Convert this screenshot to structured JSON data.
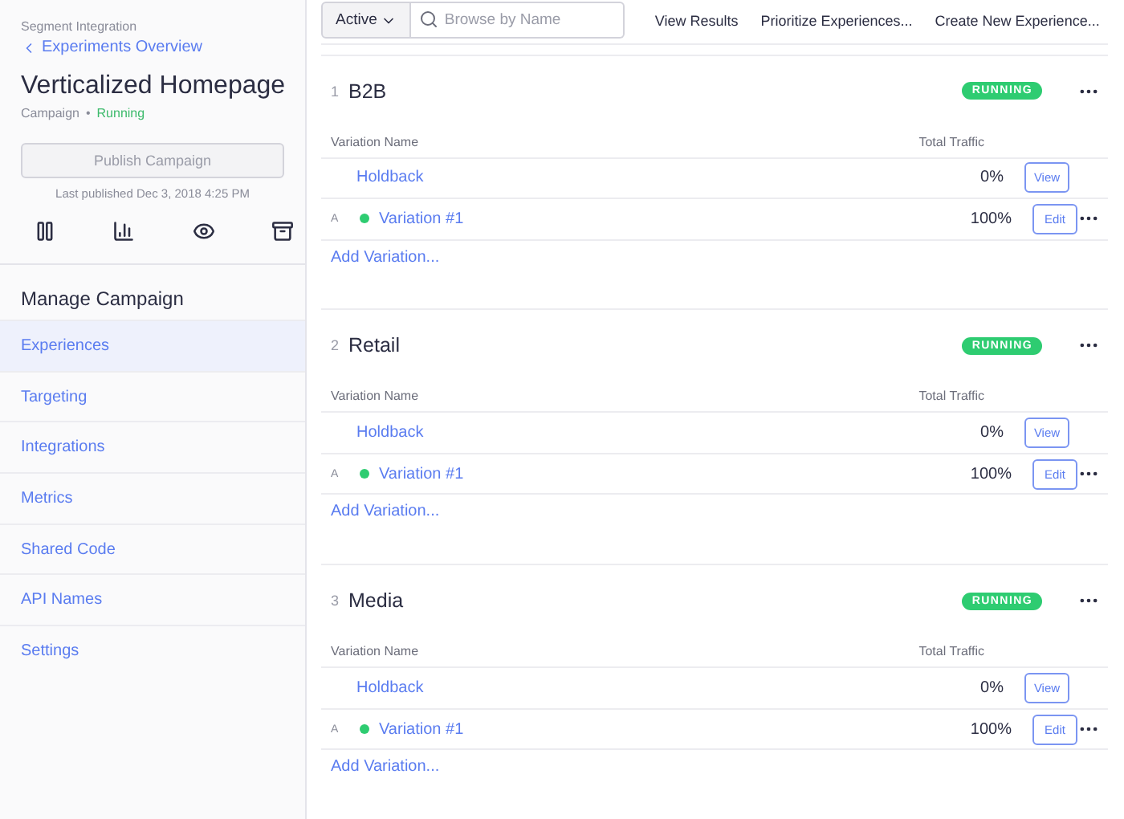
{
  "sidebar": {
    "breadcrumb": "Segment Integration",
    "back_link": "Experiments Overview",
    "title": "Verticalized Homepage",
    "type": "Campaign",
    "separator": "•",
    "status": "Running",
    "publish_button": {
      "label": "Publish Campaign",
      "disabled": true
    },
    "last_published": "Last published Dec 3, 2018 4:25 PM",
    "section_title": "Manage Campaign",
    "nav": [
      {
        "label": "Experiences",
        "selected": true
      },
      {
        "label": "Targeting",
        "selected": false
      },
      {
        "label": "Integrations",
        "selected": false
      },
      {
        "label": "Metrics",
        "selected": false
      },
      {
        "label": "Shared Code",
        "selected": false
      },
      {
        "label": "API Names",
        "selected": false
      },
      {
        "label": "Settings",
        "selected": false
      }
    ]
  },
  "toolbar": {
    "filter": "Active",
    "search": {
      "placeholder": "Browse by Name"
    },
    "actions": [
      "View Results",
      "Prioritize Experiences...",
      "Create New Experience..."
    ]
  },
  "experiences": [
    {
      "index": "1",
      "name": "B2B",
      "status": "RUNNING",
      "columns": [
        "Variation Name",
        "Total Traffic"
      ],
      "add_link": "Add Variation...",
      "variations": [
        {
          "kind": "holdback",
          "name": "Holdback",
          "traffic": "0%",
          "action": "View"
        },
        {
          "kind": "variation",
          "letter": "A",
          "color": "#2ecc71",
          "name": "Variation #1",
          "traffic": "100%",
          "action": "Edit"
        }
      ]
    },
    {
      "index": "2",
      "name": "Retail",
      "status": "RUNNING",
      "columns": [
        "Variation Name",
        "Total Traffic"
      ],
      "add_link": "Add Variation...",
      "variations": [
        {
          "kind": "holdback",
          "name": "Holdback",
          "traffic": "0%",
          "action": "View"
        },
        {
          "kind": "variation",
          "letter": "A",
          "color": "#2ecc71",
          "name": "Variation #1",
          "traffic": "100%",
          "action": "Edit"
        }
      ]
    },
    {
      "index": "3",
      "name": "Media",
      "status": "RUNNING",
      "columns": [
        "Variation Name",
        "Total Traffic"
      ],
      "add_link": "Add Variation...",
      "variations": [
        {
          "kind": "holdback",
          "name": "Holdback",
          "traffic": "0%",
          "action": "View"
        },
        {
          "kind": "variation",
          "letter": "A",
          "color": "#2ecc71",
          "name": "Variation #1",
          "traffic": "100%",
          "action": "Edit"
        }
      ]
    }
  ]
}
